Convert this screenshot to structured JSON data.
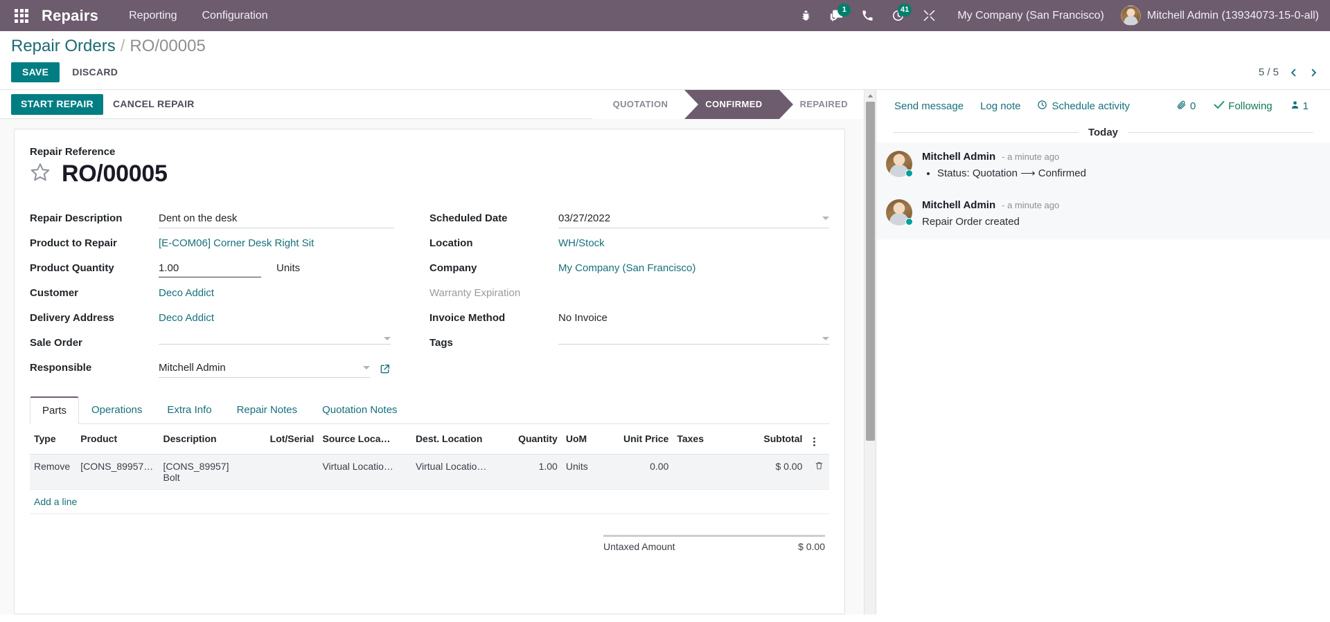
{
  "navbar": {
    "apps_icon": "grid-apps-icon",
    "brand": "Repairs",
    "menu": [
      {
        "label": "Reporting"
      },
      {
        "label": "Configuration"
      }
    ],
    "sys_icons": [
      {
        "name": "bug-icon",
        "badge": null
      },
      {
        "name": "messages-icon",
        "badge": "1"
      },
      {
        "name": "phone-icon",
        "badge": null
      },
      {
        "name": "activities-clock-icon",
        "badge": "41"
      },
      {
        "name": "developer-tools-icon",
        "badge": null
      }
    ],
    "company": "My Company (San Francisco)",
    "user": "Mitchell Admin (13934073-15-0-all)"
  },
  "control_panel": {
    "breadcrumb_root": "Repair Orders",
    "breadcrumb_sep": "/",
    "breadcrumb_current": "RO/00005",
    "save_label": "SAVE",
    "discard_label": "DISCARD",
    "pager_counter": "5 / 5",
    "pager_prev": "previous-record",
    "pager_next": "next-record"
  },
  "statusbar": {
    "start_repair_label": "START REPAIR",
    "cancel_repair_label": "CANCEL REPAIR",
    "stages": [
      {
        "label": "QUOTATION",
        "active": false
      },
      {
        "label": "CONFIRMED",
        "active": true
      },
      {
        "label": "REPAIRED",
        "active": false
      }
    ]
  },
  "form": {
    "title_label": "Repair Reference",
    "record_name": "RO/00005",
    "star_icon": "favorite-star-icon",
    "left_fields": [
      {
        "label": "Repair Description",
        "value": "Dent on the desk",
        "type": "text-input"
      },
      {
        "label": "Product to Repair",
        "value": "[E-COM06] Corner Desk Right Sit",
        "type": "link"
      },
      {
        "label": "Product Quantity",
        "value": "1.00",
        "suffix": "Units",
        "type": "number-input"
      },
      {
        "label": "Customer",
        "value": "Deco Addict",
        "type": "link"
      },
      {
        "label": "Delivery Address",
        "value": "Deco Addict",
        "type": "link"
      },
      {
        "label": "Sale Order",
        "value": "",
        "type": "select"
      },
      {
        "label": "Responsible",
        "value": "Mitchell Admin",
        "type": "select-external"
      }
    ],
    "right_fields": [
      {
        "label": "Scheduled Date",
        "value": "03/27/2022",
        "type": "date-select"
      },
      {
        "label": "Location",
        "value": "WH/Stock",
        "type": "link"
      },
      {
        "label": "Company",
        "value": "My Company (San Francisco)",
        "type": "link"
      },
      {
        "label": "Warranty Expiration",
        "value": "",
        "type": "readonly-muted"
      },
      {
        "label": "Invoice Method",
        "value": "No Invoice",
        "type": "readonly"
      },
      {
        "label": "Tags",
        "value": "",
        "type": "select"
      }
    ]
  },
  "notebook": {
    "tabs": [
      {
        "label": "Parts",
        "active": true
      },
      {
        "label": "Operations",
        "active": false
      },
      {
        "label": "Extra Info",
        "active": false
      },
      {
        "label": "Repair Notes",
        "active": false
      },
      {
        "label": "Quotation Notes",
        "active": false
      }
    ],
    "columns": [
      "Type",
      "Product",
      "Description",
      "Lot/Serial",
      "Source Loca…",
      "Dest. Location",
      "Quantity",
      "UoM",
      "Unit Price",
      "Taxes",
      "Subtotal"
    ],
    "rows": [
      {
        "type": "Remove",
        "product": "[CONS_89957]…",
        "description": "[CONS_89957] Bolt",
        "lot_serial": "",
        "source_location": "Virtual Locatio…",
        "dest_location": "Virtual Locatio…",
        "quantity": "1.00",
        "uom": "Units",
        "unit_price": "0.00",
        "taxes": "",
        "subtotal": "$ 0.00",
        "delete_icon": "trash-icon"
      }
    ],
    "add_line_label": "Add a line",
    "optional_columns_icon": "column-options-icon",
    "totals": [
      {
        "label": "Untaxed Amount",
        "value": "$ 0.00"
      }
    ]
  },
  "chatter": {
    "send_message_label": "Send message",
    "log_note_label": "Log note",
    "schedule_activity_label": "Schedule activity",
    "schedule_activity_icon": "clock-icon",
    "attachment_icon": "paperclip-icon",
    "attachment_count": "0",
    "following_icon": "check-icon",
    "following_label": "Following",
    "followers_icon": "user-icon",
    "followers_count": "1",
    "date_separator": "Today",
    "messages": [
      {
        "author": "Mitchell Admin",
        "time": "- a minute ago",
        "body": "Status: Quotation ⟶ Confirmed",
        "bulleted": true
      },
      {
        "author": "Mitchell Admin",
        "time": "- a minute ago",
        "body": "Repair Order created",
        "bulleted": false
      }
    ]
  },
  "colors": {
    "brand_purple": "#6d5b6e",
    "accent_teal": "#017e84",
    "link_teal": "#16707b",
    "badge_teal": "#00806c",
    "follow_green": "#0f7a5a"
  }
}
